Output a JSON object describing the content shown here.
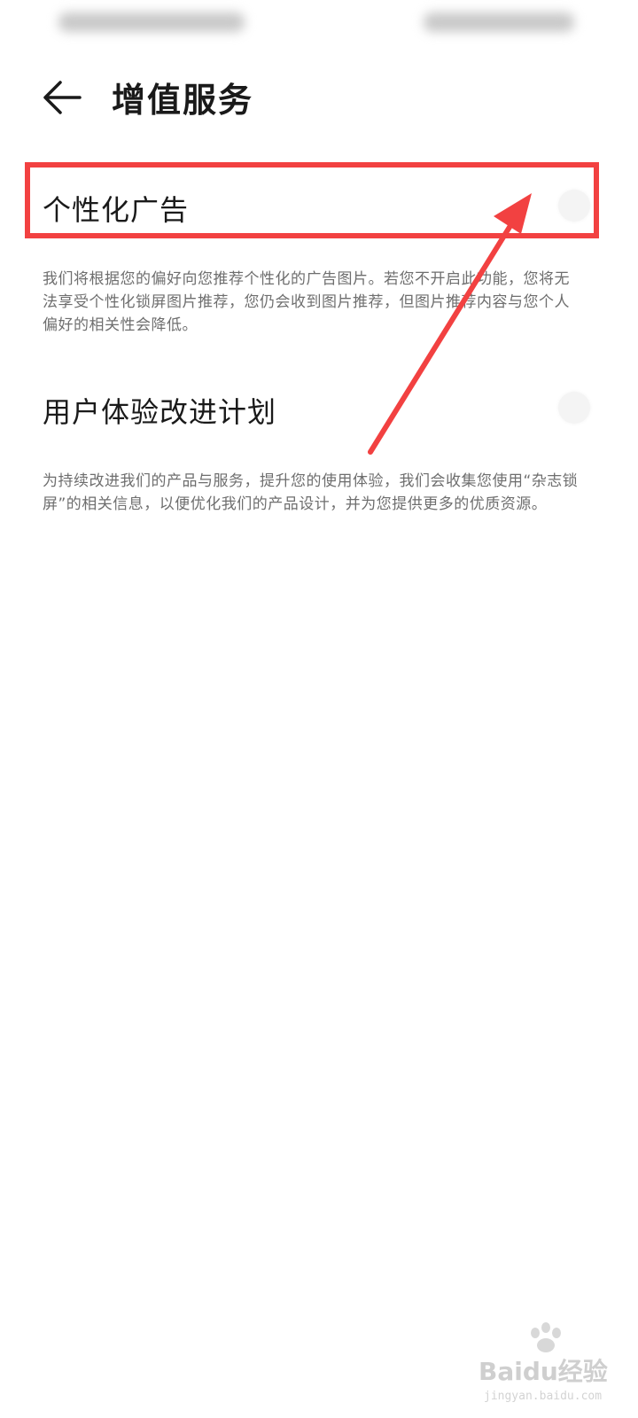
{
  "header": {
    "title": "增值服务",
    "back_icon": "arrow-left-icon"
  },
  "settings": [
    {
      "title": "个性化广告",
      "description": "我们将根据您的偏好向您推荐个性化的广告图片。若您不开启此功能，您将无法享受个性化锁屏图片推荐，您仍会收到图片推荐，但图片推荐内容与您个人偏好的相关性会降低。",
      "enabled": false
    },
    {
      "title": "用户体验改进计划",
      "description": "为持续改进我们的产品与服务，提升您的使用体验，我们会收集您使用“杂志锁屏”的相关信息，以便优化我们的产品设计，并为您提供更多的优质资源。",
      "enabled": false
    }
  ],
  "annotation": {
    "color": "#f24141"
  },
  "watermark": {
    "text": "Baidu经验",
    "url": "jingyan.baidu.com"
  }
}
